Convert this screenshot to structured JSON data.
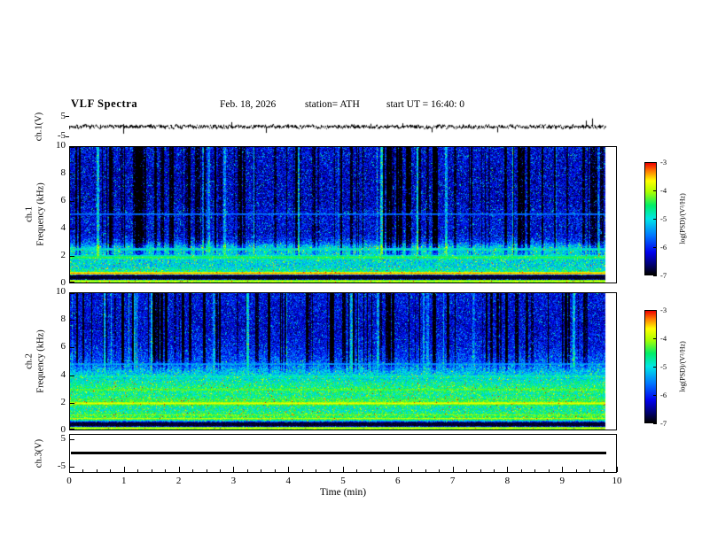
{
  "figure": {
    "title": "VLF Spectra",
    "date": "Feb. 18, 2026",
    "station": "station= ATH",
    "start_ut": "start UT =  16:40: 0"
  },
  "xaxis": {
    "label": "Time (min)",
    "min": 0,
    "max": 10,
    "ticks": [
      0,
      1,
      2,
      3,
      4,
      5,
      6,
      7,
      8,
      9,
      10
    ],
    "data_end_min": 9.8
  },
  "yaxes": {
    "ch1_wave": {
      "label": "ch.1(V)",
      "tick_top": "5",
      "tick_bottom": "-5"
    },
    "ch1_spec": {
      "channel": "ch.1",
      "axis": "Frequency (kHz)",
      "ticks": [
        0,
        2,
        4,
        6,
        8,
        10
      ]
    },
    "ch2_spec": {
      "channel": "ch.2",
      "axis": "Frequency (kHz)",
      "ticks": [
        0,
        2,
        4,
        6,
        8,
        10
      ]
    },
    "ch3_wave": {
      "label": "ch.3(V)",
      "tick_top": "5",
      "tick_bottom": "-5"
    }
  },
  "colorbar": {
    "label": "log(PSD)/(V²/Hz)",
    "ticks": [
      "-3",
      "-4",
      "-5",
      "-6",
      "-7"
    ]
  },
  "colormap_stops": [
    [
      0.0,
      "#000000"
    ],
    [
      0.08,
      "#000066"
    ],
    [
      0.2,
      "#0000ee"
    ],
    [
      0.35,
      "#0077ff"
    ],
    [
      0.5,
      "#00e6e6"
    ],
    [
      0.62,
      "#00ee66"
    ],
    [
      0.74,
      "#aaff00"
    ],
    [
      0.84,
      "#ffff00"
    ],
    [
      0.93,
      "#ff7700"
    ],
    [
      1.0,
      "#ee0000"
    ]
  ],
  "chart_data": [
    {
      "type": "line",
      "name": "ch1-voltage-trace",
      "ylabel": "ch.1(V)",
      "ylim_v": [
        -5,
        5
      ],
      "x_range_min": [
        0,
        9.8
      ],
      "description": "broadband noise around 0 V (~±1 V) with impulsive spikes to ~±4 V",
      "seed": 7,
      "band_v": 0.9,
      "spike_prob": 0.02,
      "spike_v": 3.0
    },
    {
      "type": "heatmap",
      "name": "ch1-spectrogram",
      "x_range_min": [
        0,
        9.8
      ],
      "y_range_khz": [
        0,
        10
      ],
      "z_log_psd_range": [
        -7,
        -3
      ],
      "seed": 11,
      "noise": 0.55,
      "speckle_prob": 0.1,
      "speckle_gain": 1.6,
      "base_profile": [
        [
          0,
          -4.9
        ],
        [
          0.12,
          -4.2
        ],
        [
          0.25,
          -6.9
        ],
        [
          0.5,
          -6.9
        ],
        [
          0.68,
          -4.5
        ],
        [
          0.9,
          -4.8
        ],
        [
          1.2,
          -5.1
        ],
        [
          1.6,
          -5.0
        ],
        [
          2.0,
          -5.1
        ],
        [
          2.6,
          -5.1
        ],
        [
          3.0,
          -5.9
        ],
        [
          3.6,
          -6.25
        ],
        [
          5.0,
          -6.2
        ],
        [
          6.0,
          -6.35
        ],
        [
          8.0,
          -6.35
        ],
        [
          10,
          -6.25
        ]
      ],
      "lines": [
        {
          "f": 0.1,
          "w": 0.06,
          "level": -3.8
        },
        {
          "f": 0.68,
          "w": 0.05,
          "level": -3.3
        },
        {
          "f": 1.85,
          "w": 0.08,
          "level": -4.3
        },
        {
          "f": 2.45,
          "w": 0.06,
          "level": -4.8
        },
        {
          "f": 5.05,
          "w": 0.04,
          "level": -5.4
        }
      ],
      "dark_bands": [
        {
          "f": 0.38,
          "w": 0.14
        }
      ],
      "streaks": {
        "dark_prob": 0.3,
        "bright_prob": 0.05,
        "dark_depth": 1.3,
        "bright_gain": 0.9,
        "min_freq_khz": 1.4
      }
    },
    {
      "type": "heatmap",
      "name": "ch2-spectrogram",
      "x_range_min": [
        0,
        9.8
      ],
      "y_range_khz": [
        0,
        10
      ],
      "z_log_psd_range": [
        -7,
        -3
      ],
      "seed": 29,
      "noise": 0.5,
      "speckle_prob": 0.1,
      "speckle_gain": 1.4,
      "base_profile": [
        [
          0,
          -4.8
        ],
        [
          0.12,
          -4.2
        ],
        [
          0.25,
          -6.8
        ],
        [
          0.5,
          -6.7
        ],
        [
          0.7,
          -4.6
        ],
        [
          1.0,
          -4.5
        ],
        [
          1.5,
          -4.8
        ],
        [
          2.0,
          -4.5
        ],
        [
          2.5,
          -4.7
        ],
        [
          3.0,
          -4.6
        ],
        [
          3.6,
          -4.9
        ],
        [
          4.3,
          -5.3
        ],
        [
          5.0,
          -5.8
        ],
        [
          6.0,
          -6.15
        ],
        [
          7.5,
          -6.3
        ],
        [
          10,
          -6.2
        ]
      ],
      "lines": [
        {
          "f": 0.1,
          "w": 0.06,
          "level": -3.8
        },
        {
          "f": 0.8,
          "w": 0.05,
          "level": -3.9
        },
        {
          "f": 1.06,
          "w": 0.04,
          "level": -4.1
        },
        {
          "f": 1.92,
          "w": 0.07,
          "level": -3.7
        },
        {
          "f": 2.2,
          "w": 0.05,
          "level": -4.2
        },
        {
          "f": 2.92,
          "w": 0.05,
          "level": -4.1
        },
        {
          "f": 3.9,
          "w": 0.04,
          "level": -4.6
        },
        {
          "f": 4.8,
          "w": 0.04,
          "level": -5.2
        }
      ],
      "dark_bands": [
        {
          "f": 0.38,
          "w": 0.13
        }
      ],
      "streaks": {
        "dark_prob": 0.28,
        "bright_prob": 0.05,
        "dark_depth": 1.3,
        "bright_gain": 0.8,
        "min_freq_khz": 4.0
      }
    },
    {
      "type": "line",
      "name": "ch3-voltage-trace",
      "ylabel": "ch.3(V)",
      "ylim_v": [
        -5,
        5
      ],
      "x_range_min": [
        0,
        9.8
      ],
      "value_v": 0,
      "description": "flat saturated trace at ~0 V for full record"
    }
  ]
}
